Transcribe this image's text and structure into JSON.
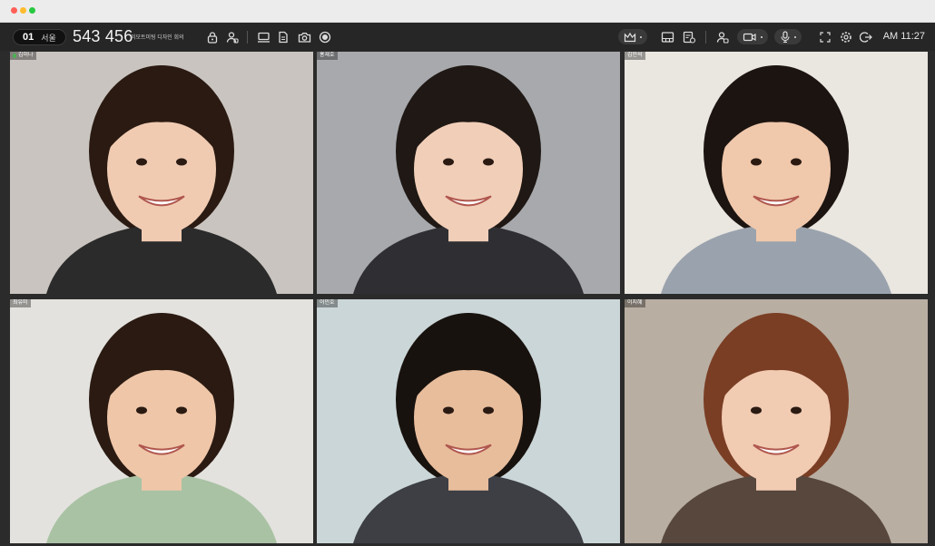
{
  "window": {
    "traffic_colors": [
      "#ff5f57",
      "#febc2e",
      "#28c840"
    ]
  },
  "toolbar": {
    "room_number": "01",
    "room_city": "서울",
    "meeting_id": "543 456",
    "meeting_title": "리모트미팅 디자인 회의",
    "clock": "AM 11:27",
    "icons": [
      "lock-icon",
      "participant-add-icon",
      "screen-share-icon",
      "document-icon",
      "camera-icon",
      "record-icon",
      "crown-icon",
      "layout-icon",
      "whiteboard-icon",
      "participants-icon",
      "video-icon",
      "microphone-icon",
      "fullscreen-icon",
      "settings-icon",
      "exit-icon"
    ]
  },
  "participants": [
    {
      "name": "김미나",
      "speaking": true,
      "bg": "#c9c4bf",
      "shirt": "#2b2b2b",
      "skin": "#f0cbb2",
      "hair": "#2a1a12"
    },
    {
      "name": "홍재호",
      "speaking": false,
      "bg": "#a7a9ad",
      "shirt": "#2f2f33",
      "skin": "#f1ceb8",
      "hair": "#1f1814"
    },
    {
      "name": "김민석",
      "speaking": false,
      "bg": "#eae6e0",
      "shirt": "#9aa3ad",
      "skin": "#f0c8ac",
      "hair": "#1c1410"
    },
    {
      "name": "최유미",
      "speaking": false,
      "bg": "#e3e2de",
      "shirt": "#a9c2a4",
      "skin": "#efc6a8",
      "hair": "#2a1a12"
    },
    {
      "name": "이민호",
      "speaking": false,
      "bg": "#cbd6d8",
      "shirt": "#3d3f45",
      "skin": "#e8bd9c",
      "hair": "#18120e"
    },
    {
      "name": "이지혜",
      "speaking": false,
      "bg": "#b9aea2",
      "shirt": "#57473d",
      "skin": "#f1cbb2",
      "hair": "#7a3e24"
    }
  ]
}
